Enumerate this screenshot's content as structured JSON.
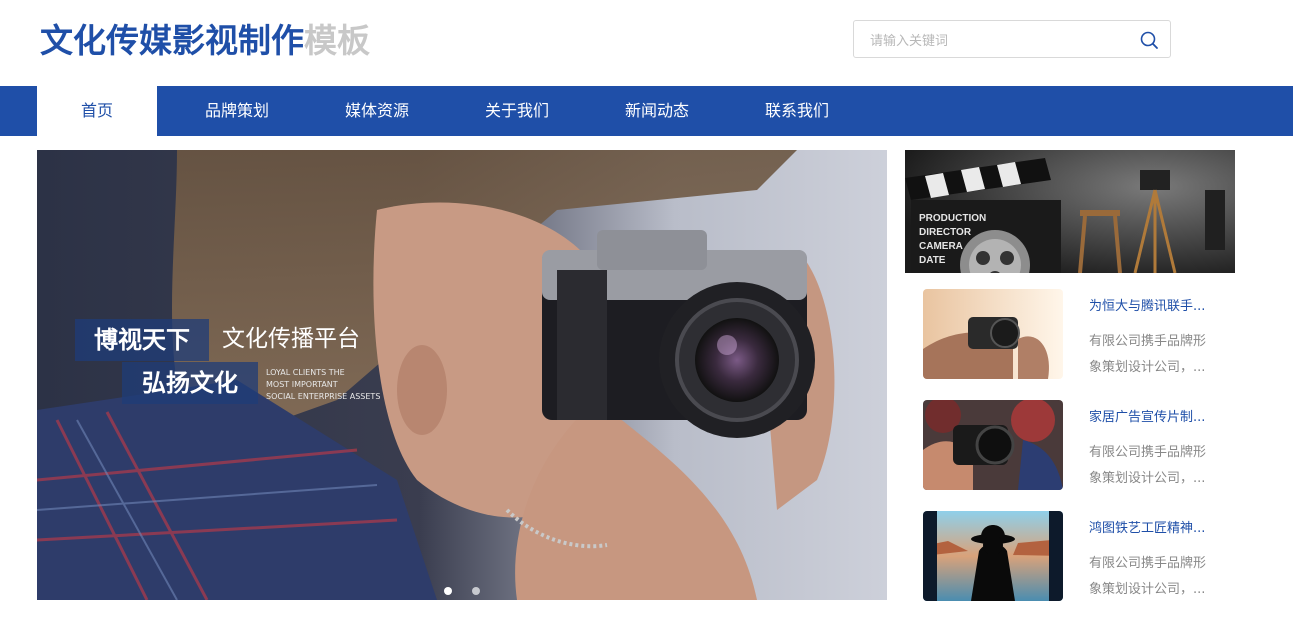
{
  "header": {
    "logo_main": "文化传媒影视制作",
    "logo_suffix": "模板",
    "search_placeholder": "请输入关键词"
  },
  "nav": {
    "items": [
      {
        "label": "首页",
        "active": true
      },
      {
        "label": "品牌策划",
        "active": false
      },
      {
        "label": "媒体资源",
        "active": false
      },
      {
        "label": "关于我们",
        "active": false
      },
      {
        "label": "新闻动态",
        "active": false
      },
      {
        "label": "联系我们",
        "active": false
      }
    ]
  },
  "banner": {
    "slogan_1": "博视天下",
    "slogan_1_sub": "文化传播平台",
    "slogan_2": "弘扬文化",
    "slogan_en": [
      "LOYAL CLIENTS THE",
      "MOST IMPORTANT",
      "SOCIAL ENTERPRISE ASSETS"
    ],
    "slate_text": [
      "PRODUCTION",
      "DIRECTOR",
      "CAMERA",
      "DATE"
    ],
    "dots_count": 2,
    "active_dot": 0
  },
  "side": {
    "news": [
      {
        "title": "为恒大与腾讯联手...",
        "desc_1": "有限公司携手品牌形",
        "desc_2": "象策划设计公司，..."
      },
      {
        "title": "家居广告宣传片制...",
        "desc_1": "有限公司携手品牌形",
        "desc_2": "象策划设计公司，..."
      },
      {
        "title": "鸿图铁艺工匠精神...",
        "desc_1": "有限公司携手品牌形",
        "desc_2": "象策划设计公司，..."
      }
    ]
  },
  "colors": {
    "brand": "#1f4fa8",
    "logo_suffix": "#c8c8c8",
    "desc_text": "#888888"
  },
  "icons": {
    "search": "search-icon"
  }
}
